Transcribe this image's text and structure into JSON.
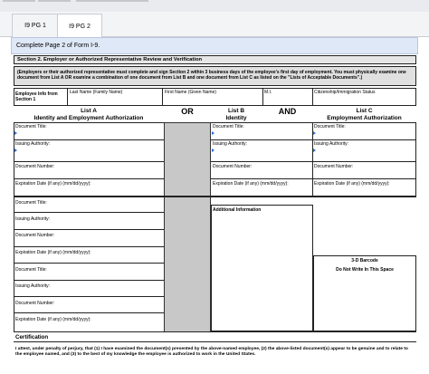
{
  "tabs": [
    {
      "label": "I9 PG 1"
    },
    {
      "label": "I9 PG 2"
    }
  ],
  "page_subtitle": "Complete Page 2 of Form I-9.",
  "section2": {
    "title": "Section 2.  Employer or Authorized Representative Review and Verification",
    "instructions": "(Employers or their authorized representative must complete and sign Section 2 within 3 business days of the employee's first day of employment. You must physically examine one document from List A OR examine a combination of one document from List B and one document from List C as listed on the \"Lists of Acceptable Documents\".)",
    "employee_info_label": "Employee Info from Section 1",
    "last_name_label": "Last Name (Family Name)",
    "first_name_label": "First Name (Given Name)",
    "mi_label": "M.I.",
    "citizenship_label": "Citizenship/Immigration Status"
  },
  "lists": {
    "a_title": "List A",
    "a_sub": "Identity and Employment Authorization",
    "or": "OR",
    "b_title": "List B",
    "b_sub": "Identity",
    "and": "AND",
    "c_title": "List C",
    "c_sub": "Employment Authorization"
  },
  "fields": {
    "doc_title": "Document Title:",
    "issuing": "Issuing Authority:",
    "doc_number": "Document Number:",
    "expiration": "Expiration Date (if any) (mm/dd/yyyy):"
  },
  "additional_info": "Additional Information",
  "barcode_title": "3-D Barcode",
  "barcode_sub": "Do Not Write In This Space",
  "certification_title": "Certification",
  "certification_text": "I attest, under penalty of perjury, that (1) I have examined the document(s) presented by the above-named employee, (2) the above-listed document(s) appear to be genuine and to relate to the employee named, and (3) to the best of my knowledge the employee is authorized to work in the United States.",
  "colors": {
    "accent": "#2a6fd6",
    "subtitle_bg": "#dfe8f6",
    "gray_column": "#c8c8c8"
  }
}
